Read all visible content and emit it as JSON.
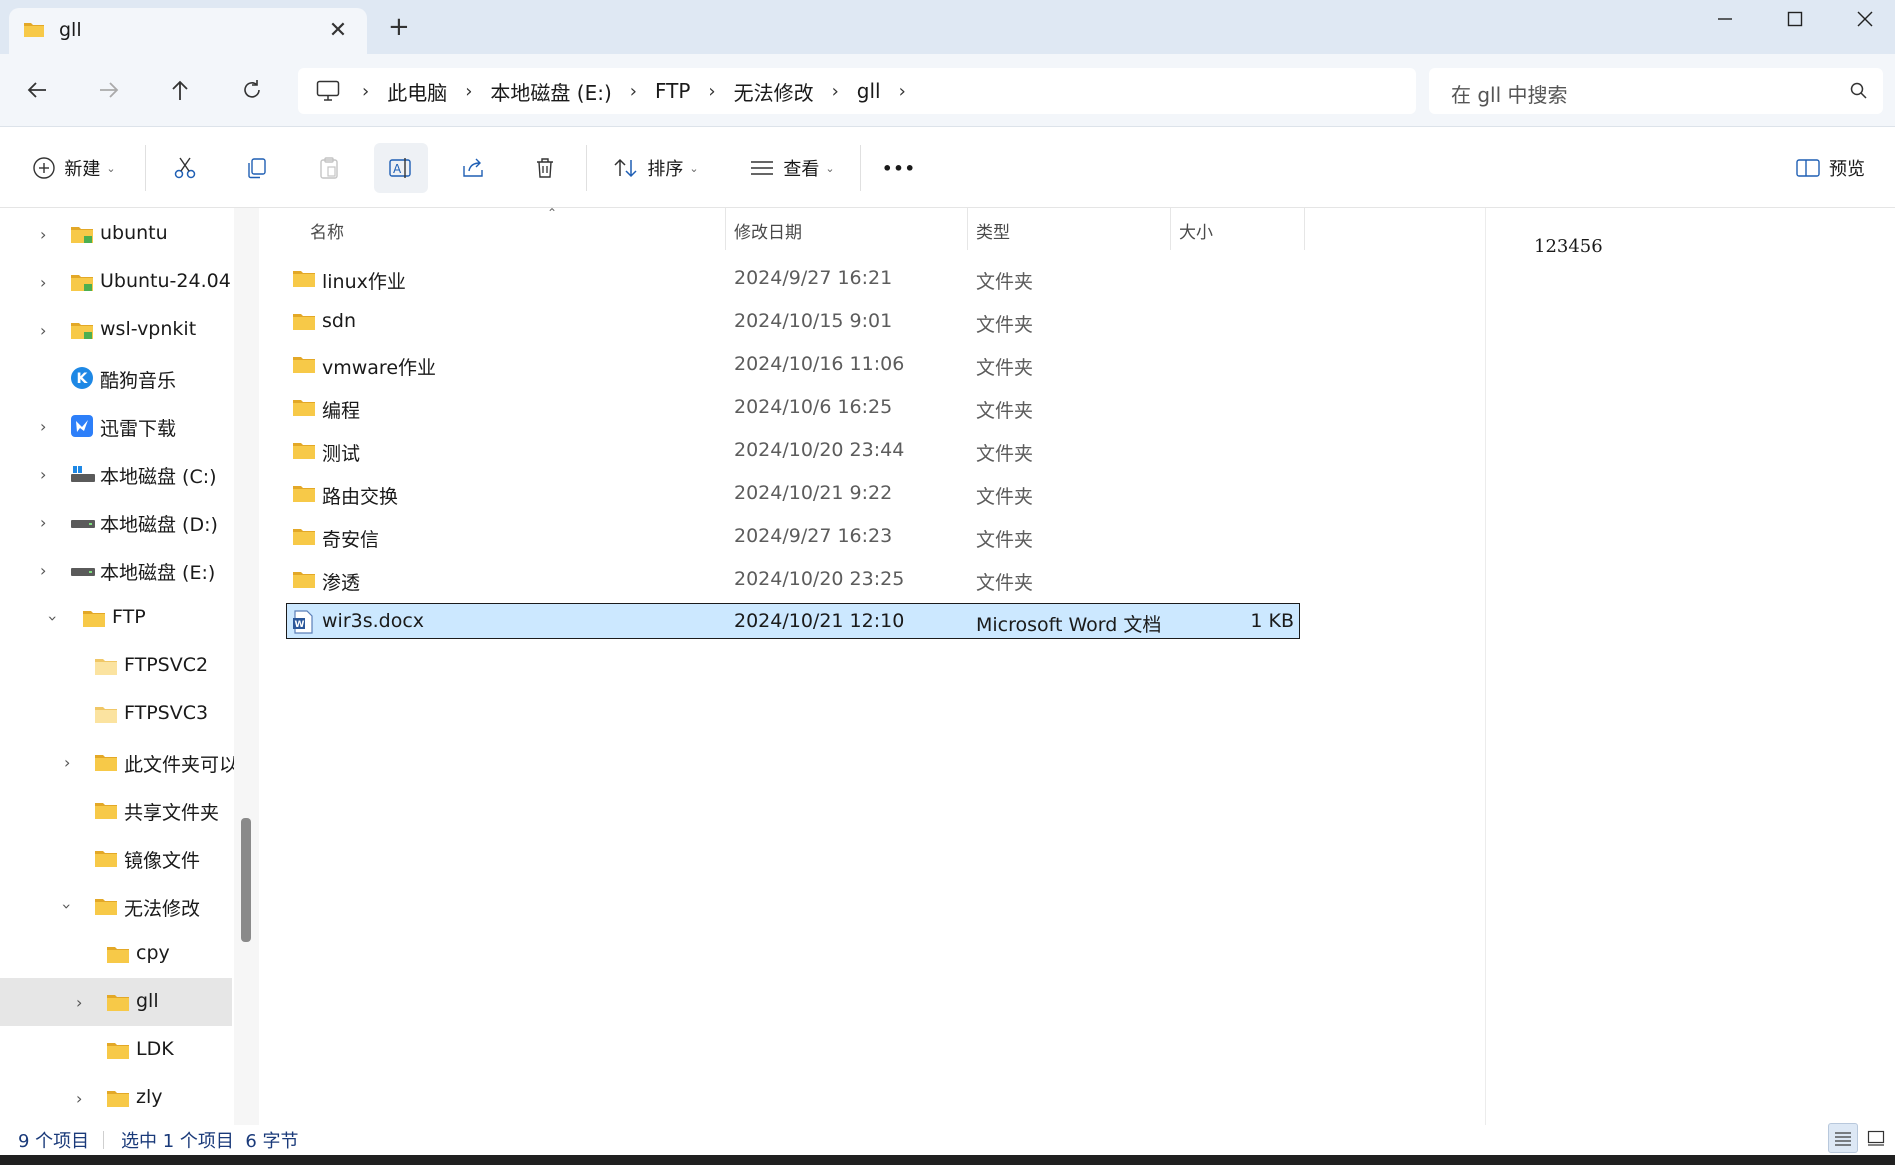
{
  "window": {
    "tab_title": "gll",
    "tab_close": "✕",
    "new_tab": "+"
  },
  "address": {
    "crumbs": [
      "此电脑",
      "本地磁盘 (E:)",
      "FTP",
      "无法修改",
      "gll"
    ],
    "separator": "›"
  },
  "search": {
    "placeholder": "在 gll 中搜索"
  },
  "toolbar": {
    "new_label": "新建",
    "sort_label": "排序",
    "view_label": "查看",
    "more_label": "•••",
    "preview_label": "预览"
  },
  "nav": {
    "items": [
      {
        "label": "ubuntu"
      },
      {
        "label": "Ubuntu-24.04"
      },
      {
        "label": "wsl-vpnkit"
      },
      {
        "label": "酷狗音乐"
      },
      {
        "label": "迅雷下载"
      },
      {
        "label": "本地磁盘 (C:)"
      },
      {
        "label": "本地磁盘 (D:)"
      },
      {
        "label": "本地磁盘 (E:)"
      },
      {
        "label": "FTP"
      },
      {
        "label": "FTPSVC2"
      },
      {
        "label": "FTPSVC3"
      },
      {
        "label": "此文件夹可以"
      },
      {
        "label": "共享文件夹"
      },
      {
        "label": "镜像文件"
      },
      {
        "label": "无法修改"
      },
      {
        "label": "cpy"
      },
      {
        "label": "gll"
      },
      {
        "label": "LDK"
      },
      {
        "label": "zly"
      }
    ]
  },
  "columns": {
    "name": "名称",
    "modified": "修改日期",
    "type": "类型",
    "size": "大小"
  },
  "files": [
    {
      "name": "linux作业",
      "modified": "2024/9/27 16:21",
      "type": "文件夹",
      "size": ""
    },
    {
      "name": "sdn",
      "modified": "2024/10/15 9:01",
      "type": "文件夹",
      "size": ""
    },
    {
      "name": "vmware作业",
      "modified": "2024/10/16 11:06",
      "type": "文件夹",
      "size": ""
    },
    {
      "name": "编程",
      "modified": "2024/10/6 16:25",
      "type": "文件夹",
      "size": ""
    },
    {
      "name": "测试",
      "modified": "2024/10/20 23:44",
      "type": "文件夹",
      "size": ""
    },
    {
      "name": "路由交换",
      "modified": "2024/10/21 9:22",
      "type": "文件夹",
      "size": ""
    },
    {
      "name": "奇安信",
      "modified": "2024/9/27 16:23",
      "type": "文件夹",
      "size": ""
    },
    {
      "name": "渗透",
      "modified": "2024/10/20 23:25",
      "type": "文件夹",
      "size": ""
    },
    {
      "name": "wir3s.docx",
      "modified": "2024/10/21 12:10",
      "type": "Microsoft Word 文档",
      "size": "1 KB"
    }
  ],
  "preview": {
    "content": "123456"
  },
  "status": {
    "item_count": "9 个项目",
    "selection": "选中 1 个项目  6 字节"
  },
  "colors": {
    "folder": "#f7c948",
    "folder_dark": "#e3a827",
    "selection_bg": "#cce8ff",
    "titlebar_bg": "#dfe8f3",
    "status_text": "#1a3a7a"
  }
}
